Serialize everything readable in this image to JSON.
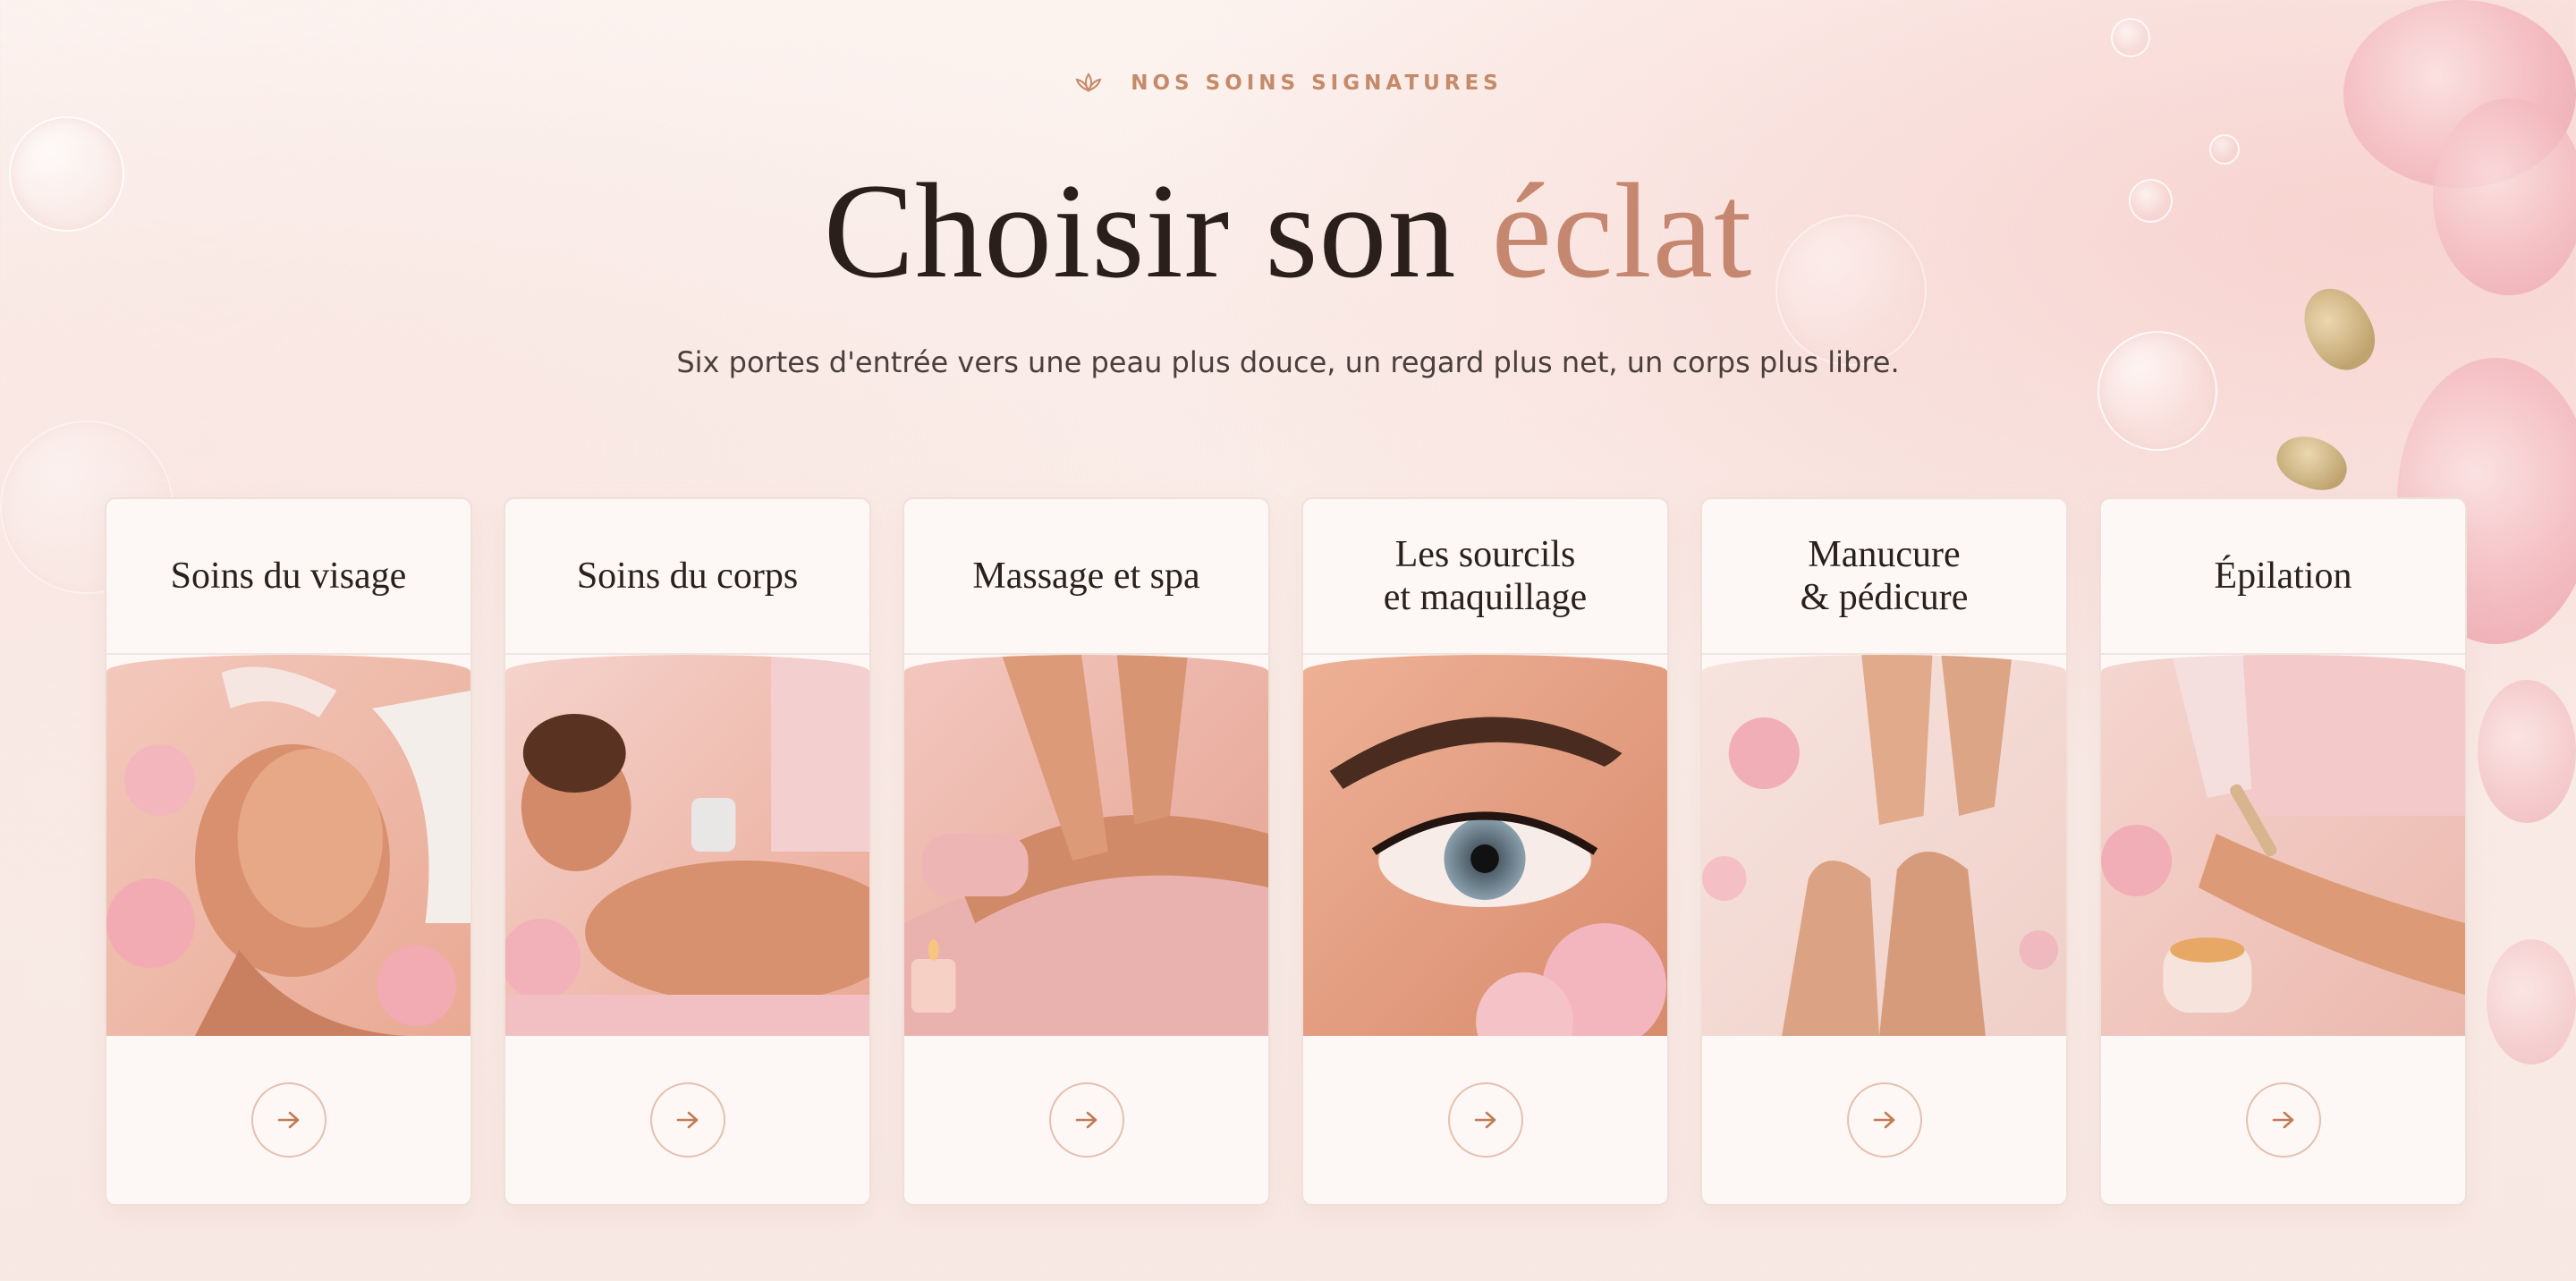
{
  "header": {
    "eyebrow": "NOS SOINS SIGNATURES",
    "eyebrow_icon": "lotus-icon",
    "title_main": "Choisir son ",
    "title_accent": "éclat",
    "subtitle": "Six portes d'entrée vers une peau plus douce, un regard plus net, un corps plus libre."
  },
  "colors": {
    "accent": "#c68770",
    "eyebrow": "#c58a6a",
    "text": "#2a1f1b",
    "card_bg": "#fdf8f5",
    "arrow_border": "#e5c0ad"
  },
  "cards": [
    {
      "title": "Soins du visage",
      "image": "facial-treatment-photo",
      "button_icon": "arrow-right-icon"
    },
    {
      "title": "Soins du corps",
      "image": "body-treatment-photo",
      "button_icon": "arrow-right-icon"
    },
    {
      "title": "Massage et spa",
      "image": "massage-photo",
      "button_icon": "arrow-right-icon"
    },
    {
      "title": "Les sourcils\net maquillage",
      "image": "eyebrow-makeup-photo",
      "button_icon": "arrow-right-icon"
    },
    {
      "title": "Manucure\n& pédicure",
      "image": "manicure-pedicure-photo",
      "button_icon": "arrow-right-icon"
    },
    {
      "title": "Épilation",
      "image": "waxing-photo",
      "button_icon": "arrow-right-icon"
    }
  ]
}
